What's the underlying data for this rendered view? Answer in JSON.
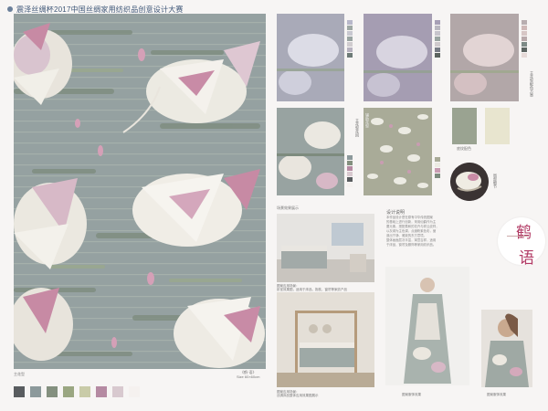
{
  "header": {
    "title": "震泽丝绸杯2017中国丝绸家用纺织品创意设计大赛"
  },
  "main": {
    "label_left": "主花型",
    "label_right_1": "《鹤·语》",
    "label_right_2": "Size 60×60cm",
    "colors": [
      "#595c5f",
      "#8c999b",
      "#84907f",
      "#9aa681",
      "#c9cba8",
      "#b58aa2",
      "#d8c9cf",
      "#f5f1ef"
    ]
  },
  "right": {
    "colorway_chips": [
      [
        "#b8b8ca",
        "#9ea8a4",
        "#c8c8d0",
        "#9aa5a2",
        "#d0cccf",
        "#b7b2bf",
        "#6e7b77"
      ],
      [
        "#a7a0b6",
        "#b9b7c0",
        "#c7c5cc",
        "#9aa5a2",
        "#cfcacd",
        "#787c86",
        "#5c6460"
      ],
      [
        "#b8aeb0",
        "#cfb8b7",
        "#d7c6c5",
        "#b9a9ab",
        "#7d8a86",
        "#5d6562",
        "#e6dad8"
      ]
    ],
    "small_label_1": "主花型配色方案",
    "small_label_2": "辅助花型",
    "small_label_3": "主花型花回",
    "small_label_4": "底纹配色",
    "small_label_5": "局部细节"
  },
  "lower": {
    "section_label": "场景效果展示",
    "design_heading": "设计说明",
    "design_text": [
      "本作品设计是在原有中华传统图案",
      "的基础上进行创新，采用仙鹤作为主",
      "要元素，搭配柔和的花卉与祥云纹样，",
      "以灰绿为主色调，点缀粉紫色彩，营",
      "造出宁静、雅致的东方意境。",
      "整体画面层次丰富，寓意吉祥，适用",
      "于床品、窗帘及服饰等家用纺织品。"
    ],
    "cap_room1_a": "图案应用场景：",
    "cap_room1_b": "卧室效果图，适用于床品、抱枕、窗帘等家纺产品",
    "cap_room2_a": "图案应用场景：",
    "cap_room2_b": "丝绸床品整体应用效果图展示",
    "cap_fashion_1": "图案服饰效果",
    "cap_fashion_2": "图案服饰效果"
  },
  "brand": {
    "char1": "鹤",
    "char2": "语"
  }
}
